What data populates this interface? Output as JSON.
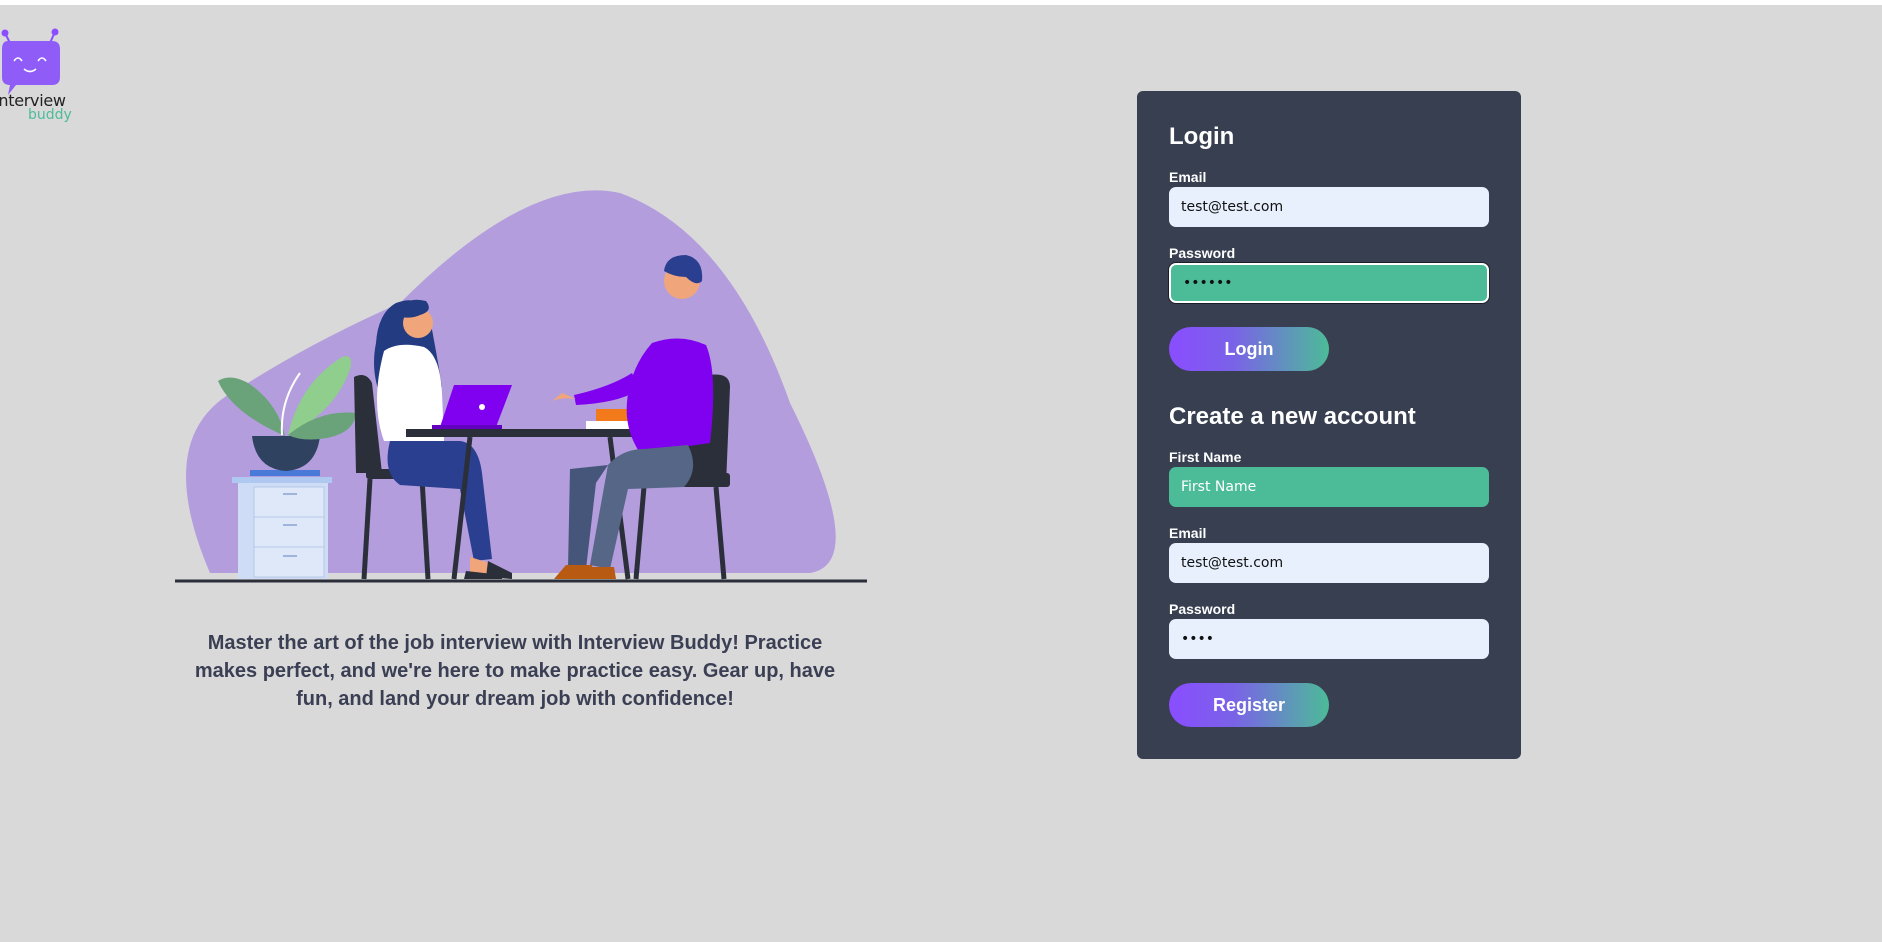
{
  "brand": {
    "logo_word": "Interview",
    "logo_sub": "buddy",
    "logo_icon": "chat-robot-icon",
    "accent_purple": "#8a4dff",
    "accent_green": "#4cbb98"
  },
  "hero": {
    "illustration": "interview-illustration",
    "tagline": "Master the art of the job interview with Interview Buddy! Practice makes perfect, and we're here to make practice easy. Gear up, have fun, and land your dream job with confidence!"
  },
  "login": {
    "title": "Login",
    "email_label": "Email",
    "email_value": "test@test.com",
    "password_label": "Password",
    "password_value": "••••••",
    "button_label": "Login"
  },
  "register": {
    "title": "Create a new account",
    "first_name_label": "First Name",
    "first_name_placeholder": "First Name",
    "email_label": "Email",
    "email_value": "test@test.com",
    "password_label": "Password",
    "password_value": "••••",
    "button_label": "Register"
  }
}
